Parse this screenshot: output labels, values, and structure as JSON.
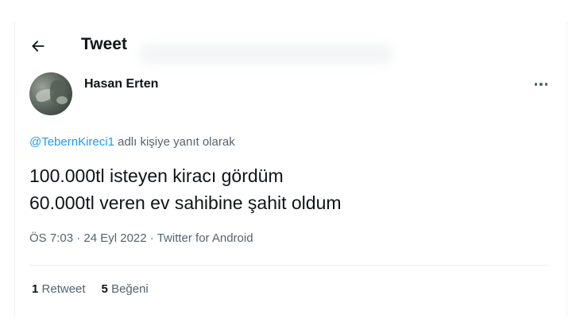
{
  "header": {
    "title": "Tweet",
    "back_icon": "arrow-left-icon"
  },
  "tweet": {
    "author_name": "Hasan Erten",
    "more_icon": "more-horizontal-icon",
    "reply_to": {
      "mention": "@TebernKireci1",
      "suffix": " adlı kişiye yanıt olarak"
    },
    "text_lines": [
      "100.000tl isteyen kiracı gördüm",
      "60.000tl veren ev sahibine şahit oldum"
    ],
    "time": "ÖS 7:03",
    "separator": " · ",
    "date": "24 Eyl 2022",
    "source": "Twitter for Android",
    "stats": {
      "retweets_count": "1",
      "retweets_label": "Retweet",
      "likes_count": "5",
      "likes_label": "Beğeni"
    }
  },
  "colors": {
    "text": "#0f1419",
    "secondary": "#536471",
    "link": "#1d9bf0",
    "divider": "#e6ecf0"
  }
}
